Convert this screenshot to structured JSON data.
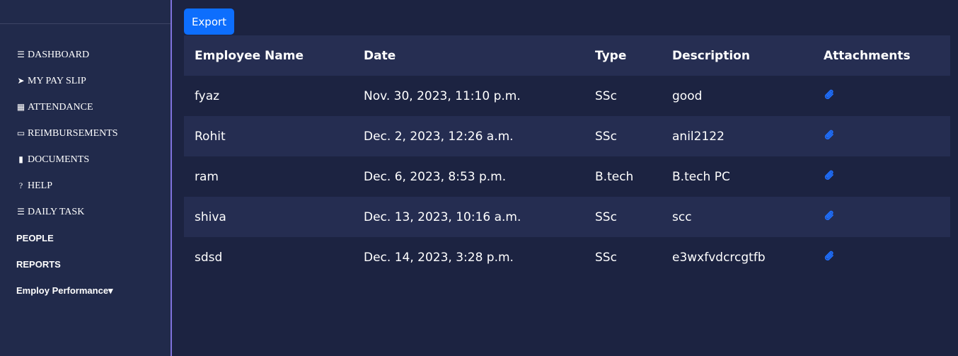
{
  "sidebar": {
    "items": [
      {
        "label": "DASHBOARD",
        "icon": "bars-icon",
        "glyph": "☰"
      },
      {
        "label": "MY PAY SLIP",
        "icon": "paper-plane-icon",
        "glyph": "➤"
      },
      {
        "label": "ATTENDANCE",
        "icon": "calendar-icon",
        "glyph": "▦"
      },
      {
        "label": "REIMBURSEMENTS",
        "icon": "credit-card-icon",
        "glyph": "▭"
      },
      {
        "label": "DOCUMENTS",
        "icon": "file-icon",
        "glyph": "▮"
      },
      {
        "label": "HELP",
        "icon": "question-circle-icon",
        "glyph": "?"
      },
      {
        "label": "DAILY TASK",
        "icon": "tasks-icon",
        "glyph": "☰"
      },
      {
        "label": "PEOPLE"
      },
      {
        "label": "REPORTS"
      },
      {
        "label": "Employ Performance▾"
      }
    ]
  },
  "toolbar": {
    "export_label": "Export"
  },
  "table": {
    "headers": [
      "Employee Name",
      "Date",
      "Type",
      "Description",
      "Attachments"
    ],
    "rows": [
      [
        "fyaz",
        "Nov. 30, 2023, 11:10 p.m.",
        "SSc",
        "good"
      ],
      [
        "Rohit",
        "Dec. 2, 2023, 12:26 a.m.",
        "SSc",
        "anil2122"
      ],
      [
        "ram",
        "Dec. 6, 2023, 8:53 p.m.",
        "B.tech",
        "B.tech PC"
      ],
      [
        "shiva",
        "Dec. 13, 2023, 10:16 a.m.",
        "SSc",
        "scc"
      ],
      [
        "sdsd",
        "Dec. 14, 2023, 3:28 p.m.",
        "SSc",
        "e3wxfvdcrcgtfb"
      ]
    ],
    "attachment_icon": "paperclip-icon"
  },
  "colors": {
    "accent": "#0d6efd",
    "sidebar_border": "#7f72dc",
    "attachment": "#1e6fff"
  }
}
